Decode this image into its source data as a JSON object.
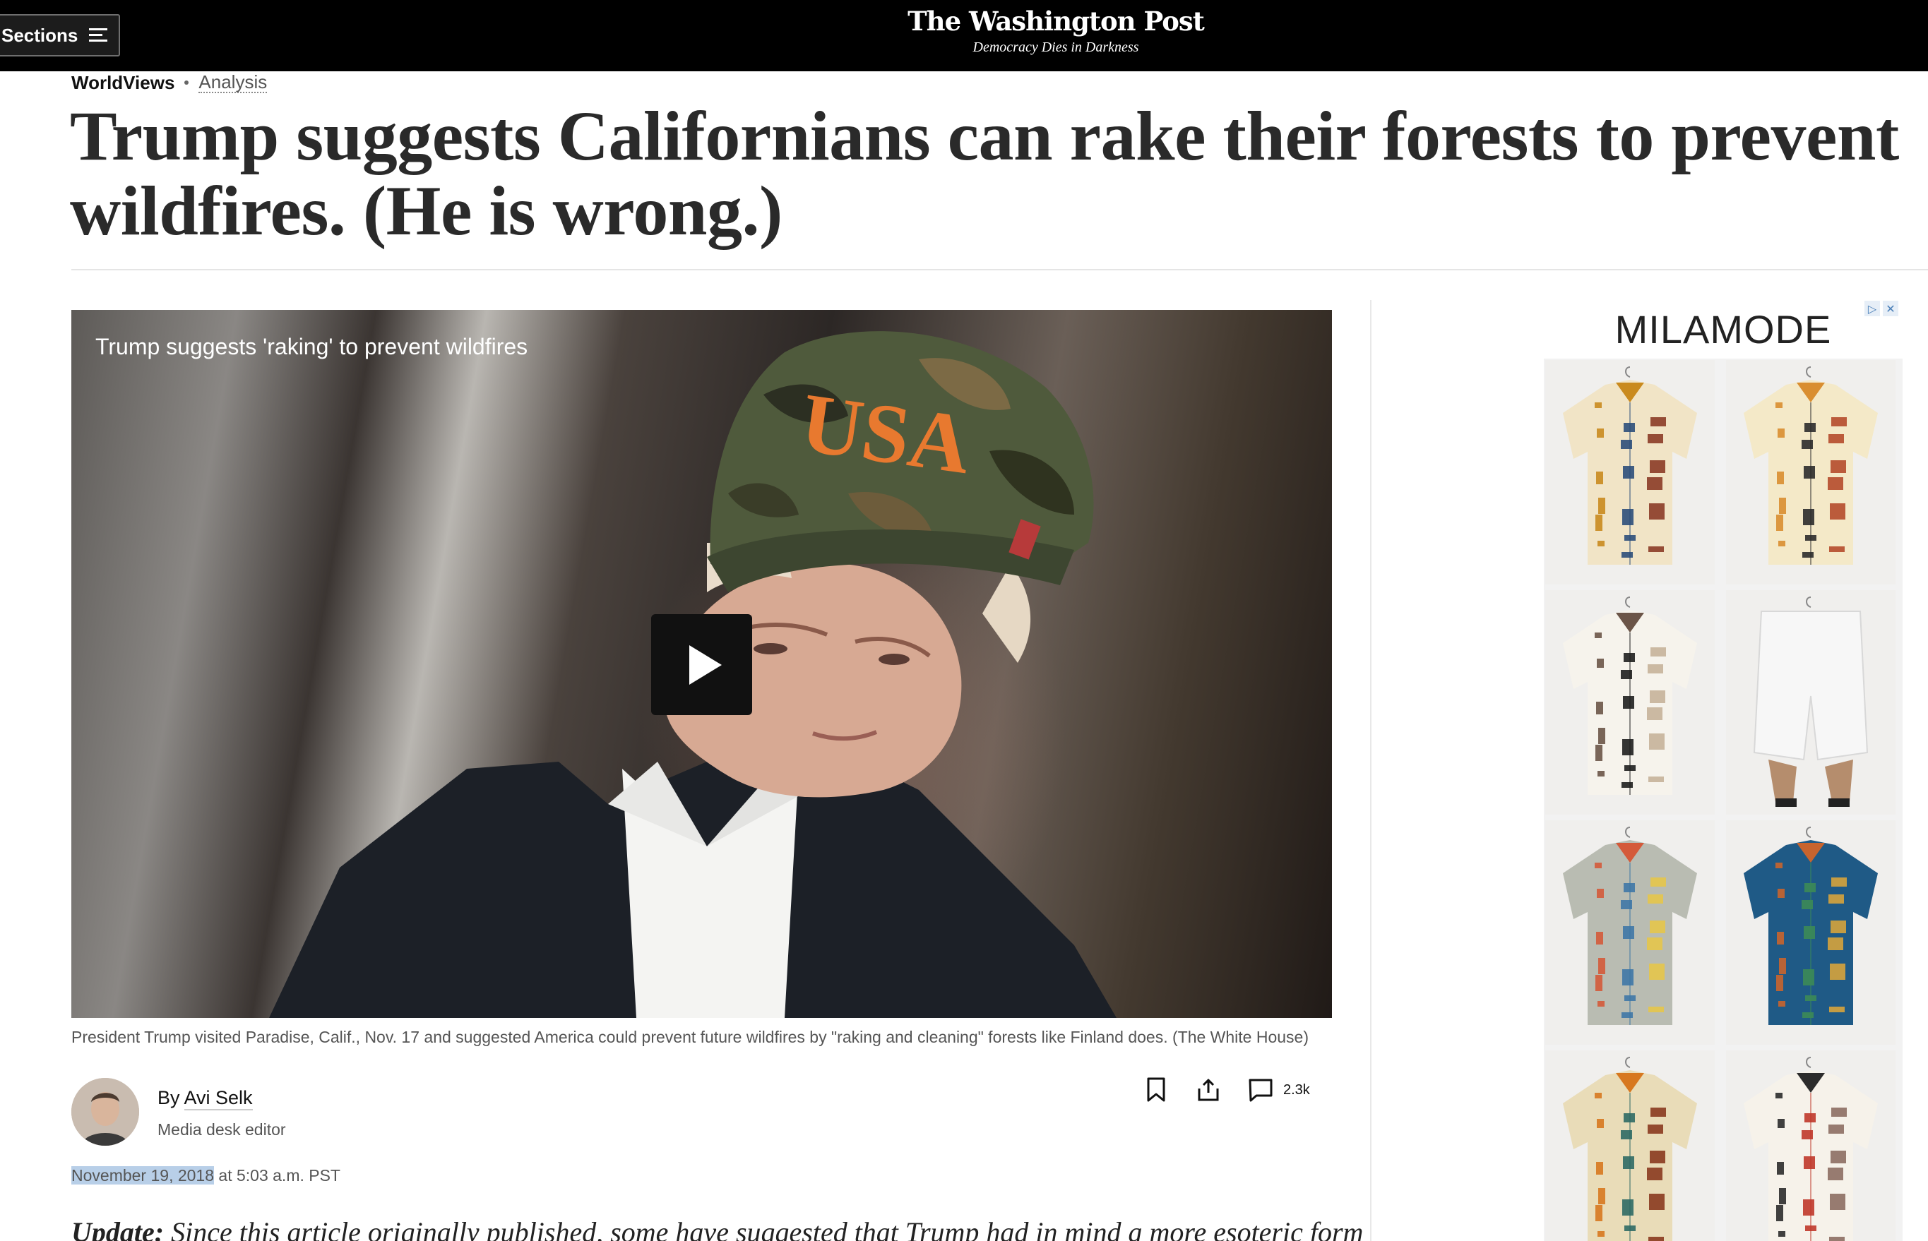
{
  "topbar": {
    "sections_label": "Sections",
    "masthead_title": "The Washington Post",
    "masthead_tagline": "Democracy Dies in Darkness"
  },
  "kicker": {
    "section": "WorldViews",
    "label": "Analysis"
  },
  "headline": "Trump suggests Californians can rake their forests to prevent wildfires. (He is wrong.)",
  "video": {
    "title": "Trump suggests 'raking' to prevent wildfires",
    "cap_text": "USA",
    "caption": "President Trump visited Paradise, Calif., Nov. 17 and suggested America could prevent future wildfires by \"raking and cleaning\" forests like Finland does. (The White House)"
  },
  "byline": {
    "by": "By",
    "author": "Avi Selk",
    "author_title": "Media desk editor",
    "comment_count": "2.3k"
  },
  "dateline": {
    "date": "November 19, 2018",
    "time": " at 5:03 a.m. PST"
  },
  "body": {
    "update_label": "Update:",
    "update_text": " Since this article originally published, some have suggested that Trump had in mind a more esoteric form"
  },
  "ad": {
    "brand": "MILAMODE",
    "choices_icon": "▷",
    "close_icon": "✕",
    "tiles": [
      {
        "name": "ad-tile-shirt-geometric",
        "colors": [
          "#f1e4c6",
          "#c98a1e",
          "#2c4e7a",
          "#8b3b26"
        ]
      },
      {
        "name": "ad-tile-shirt-cocktail",
        "colors": [
          "#f4e9c8",
          "#d98e30",
          "#2c2c2c",
          "#b54b2b"
        ]
      },
      {
        "name": "ad-tile-shirt-stripe",
        "colors": [
          "#f6f3ec",
          "#6b5548",
          "#1f1f1f",
          "#c7b29a"
        ]
      },
      {
        "name": "ad-tile-shorts-white",
        "colors": [
          "#f7f7f7",
          "#d8d8d8",
          "#b58d6d",
          "#222222"
        ]
      },
      {
        "name": "ad-tile-shirt-fish",
        "colors": [
          "#b9bcb2",
          "#d45a3a",
          "#3f77a6",
          "#e5c54a"
        ]
      },
      {
        "name": "ad-tile-shirt-vertical-stripes",
        "colors": [
          "#1f5a86",
          "#c8642e",
          "#3c8a57",
          "#d6a33c"
        ]
      },
      {
        "name": "ad-tile-shirt-retro",
        "colors": [
          "#e9dcb8",
          "#d7781f",
          "#2f6a65",
          "#8a3a1f"
        ]
      },
      {
        "name": "ad-tile-shirt-pattern",
        "colors": [
          "#f6f2ea",
          "#2c2c2c",
          "#c0392b",
          "#8d6e63"
        ]
      }
    ]
  }
}
